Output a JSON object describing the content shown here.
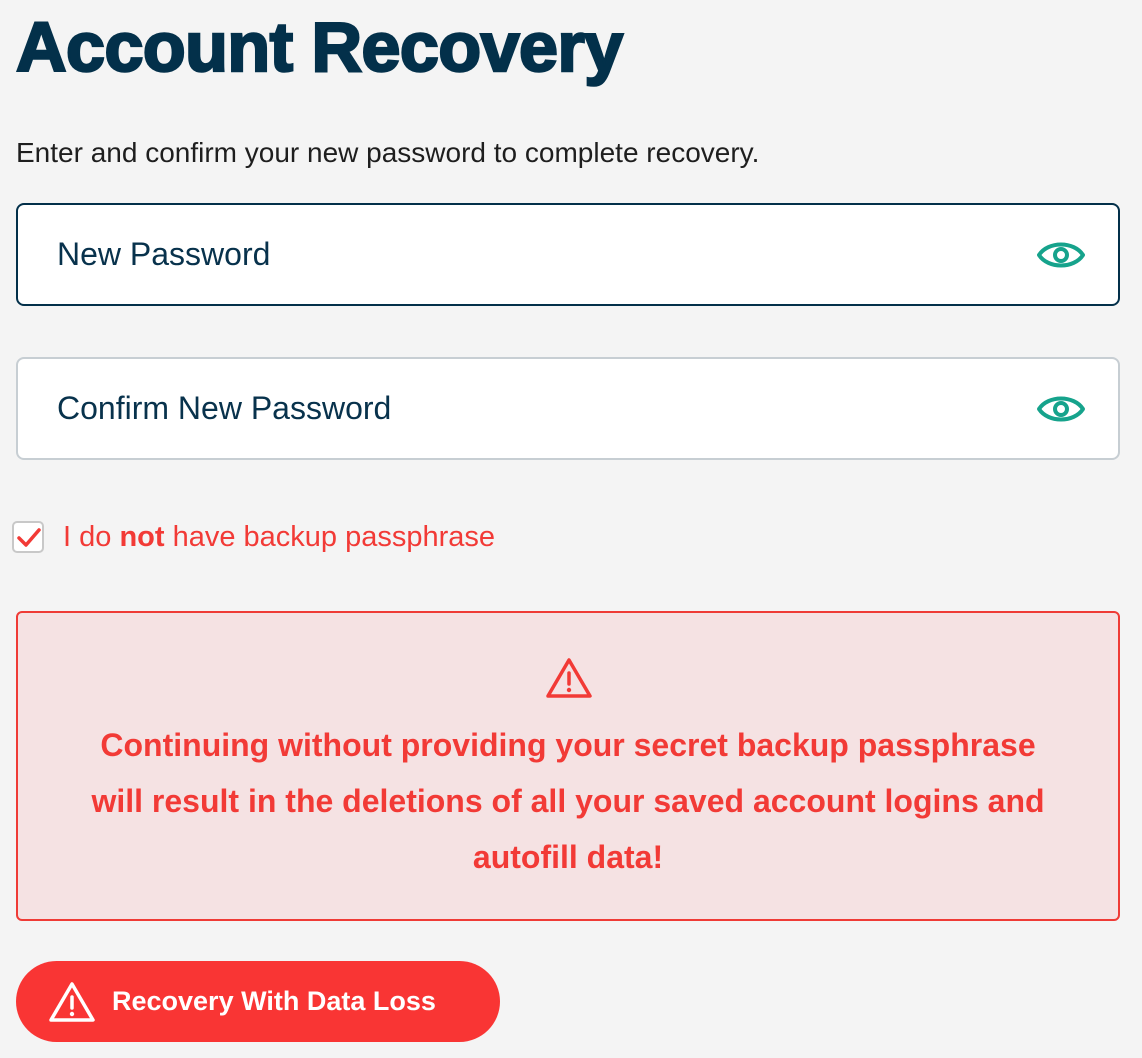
{
  "header": {
    "title": "Account Recovery",
    "subtitle": "Enter and confirm your new password to complete recovery."
  },
  "form": {
    "new_password": {
      "placeholder": "New Password",
      "value": "",
      "toggle_icon": "eye-icon"
    },
    "confirm_password": {
      "placeholder": "Confirm New Password",
      "value": "",
      "toggle_icon": "eye-icon"
    },
    "no_backup_checkbox": {
      "checked": true,
      "label_prefix": "I do ",
      "label_bold": "not",
      "label_suffix": " have backup passphrase"
    }
  },
  "warning": {
    "icon": "warning-triangle-icon",
    "message": "Continuing without providing your secret backup passphrase will result in the deletions of all your saved account logins and autofill data!"
  },
  "actions": {
    "recovery_button_label": "Recovery With Data Loss",
    "recovery_button_icon": "warning-triangle-icon"
  },
  "colors": {
    "title": "#03304a",
    "accent_teal": "#16a38c",
    "danger": "#f23a36",
    "danger_button": "#f93534",
    "warning_bg": "#f5e2e3",
    "page_bg": "#f4f4f4"
  }
}
